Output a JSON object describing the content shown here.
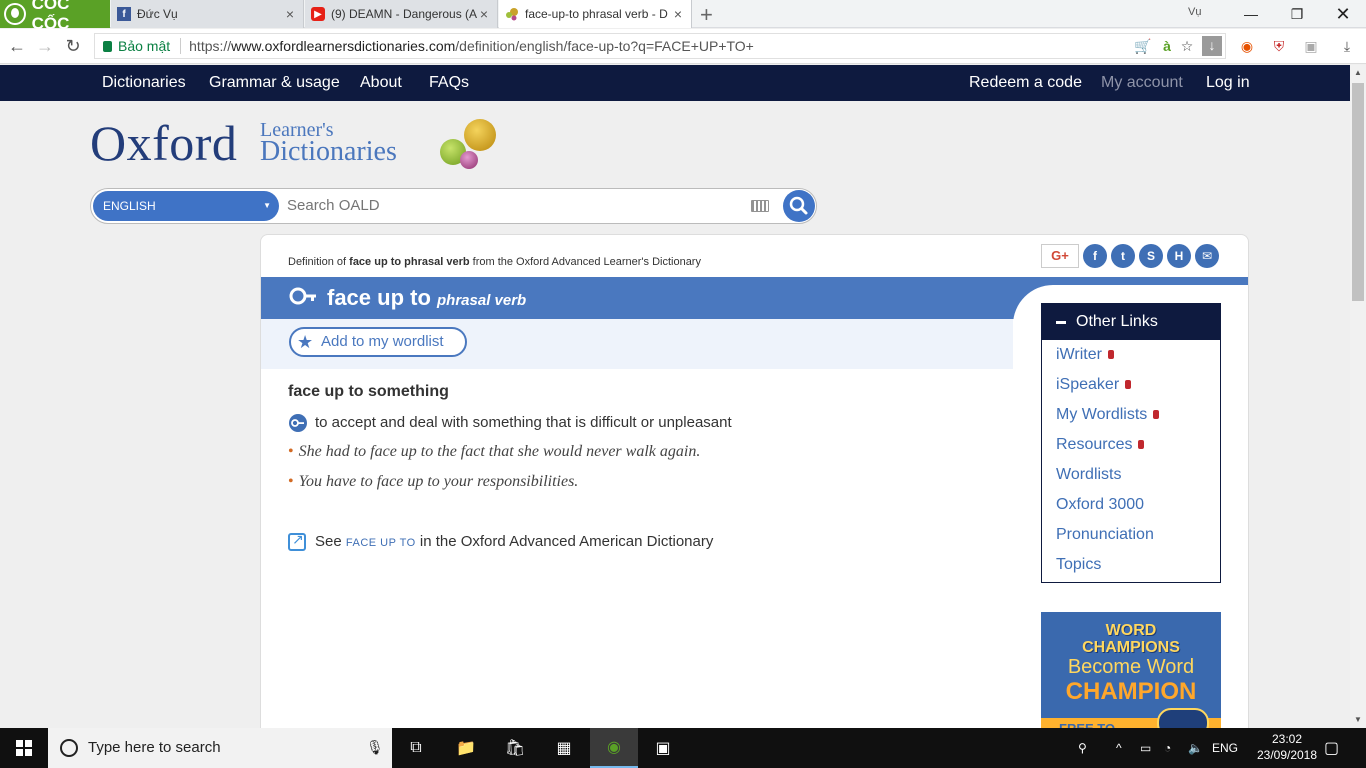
{
  "browser": {
    "brand": "CỐC CỐC",
    "tabs": [
      {
        "title": "Đức Vụ",
        "favicon": "facebook-icon"
      },
      {
        "title": "(9) DEAMN - Dangerous (A",
        "favicon": "youtube-icon"
      },
      {
        "title": "face-up-to phrasal verb - D",
        "favicon": "oxford-icon",
        "active": true
      }
    ],
    "profile": "Vụ",
    "secure_label": "Bảo mật",
    "url_prefix": "https://",
    "url_host": "www.oxfordlearnersdictionaries.com",
    "url_path": "/definition/english/face-up-to?q=FACE+UP+TO+"
  },
  "site_nav": {
    "left": [
      "Dictionaries",
      "Grammar & usage",
      "About",
      "FAQs"
    ],
    "redeem": "Redeem a code",
    "account": "My account",
    "login": "Log in"
  },
  "logo": {
    "main": "Oxford",
    "line1": "Learner's",
    "line2": "Dictionaries"
  },
  "search": {
    "language": "ENGLISH",
    "placeholder": "Search OALD"
  },
  "entry": {
    "def_prefix": "Definition of ",
    "def_word": "face up to phrasal verb",
    "def_suffix": " from the Oxford Advanced Learner's Dictionary",
    "headword": "face up to",
    "pos": "phrasal verb",
    "wordlist_button": "Add to my wordlist",
    "idiom": "face up to something",
    "definition": "to accept and deal with something that is difficult or unpleasant",
    "examples": [
      "She had to face up to the fact that she would never walk again.",
      "You have to face up to your responsibilities."
    ],
    "see_prefix": "See",
    "see_word": "face up to",
    "see_suffix": "in the Oxford Advanced American Dictionary"
  },
  "share": {
    "gplus": "G+",
    "icons": [
      "facebook-icon",
      "twitter-icon",
      "stumbleupon-icon",
      "hatena-icon",
      "email-icon"
    ]
  },
  "other_links": {
    "title": "Other Links",
    "items": [
      {
        "label": "iWriter",
        "locked": true
      },
      {
        "label": "iSpeaker",
        "locked": true
      },
      {
        "label": "My Wordlists",
        "locked": true
      },
      {
        "label": "Resources",
        "locked": true
      },
      {
        "label": "Wordlists",
        "locked": false
      },
      {
        "label": "Oxford 3000",
        "locked": false
      },
      {
        "label": "Pronunciation",
        "locked": false
      },
      {
        "label": "Topics",
        "locked": false
      }
    ]
  },
  "promo": {
    "line1": "WORD",
    "line2": "CHAMPIONS",
    "line3": "Become Word",
    "line4": "CHAMPION",
    "line5": "FREE TO"
  },
  "taskbar": {
    "search_placeholder": "Type here to search",
    "lang": "ENG",
    "time": "23:02",
    "date": "23/09/2018"
  },
  "colors": {
    "nav": "#0e1a3f",
    "accent": "#4a78bf",
    "link": "#3f6fb5",
    "example_dot": "#d26b25"
  }
}
